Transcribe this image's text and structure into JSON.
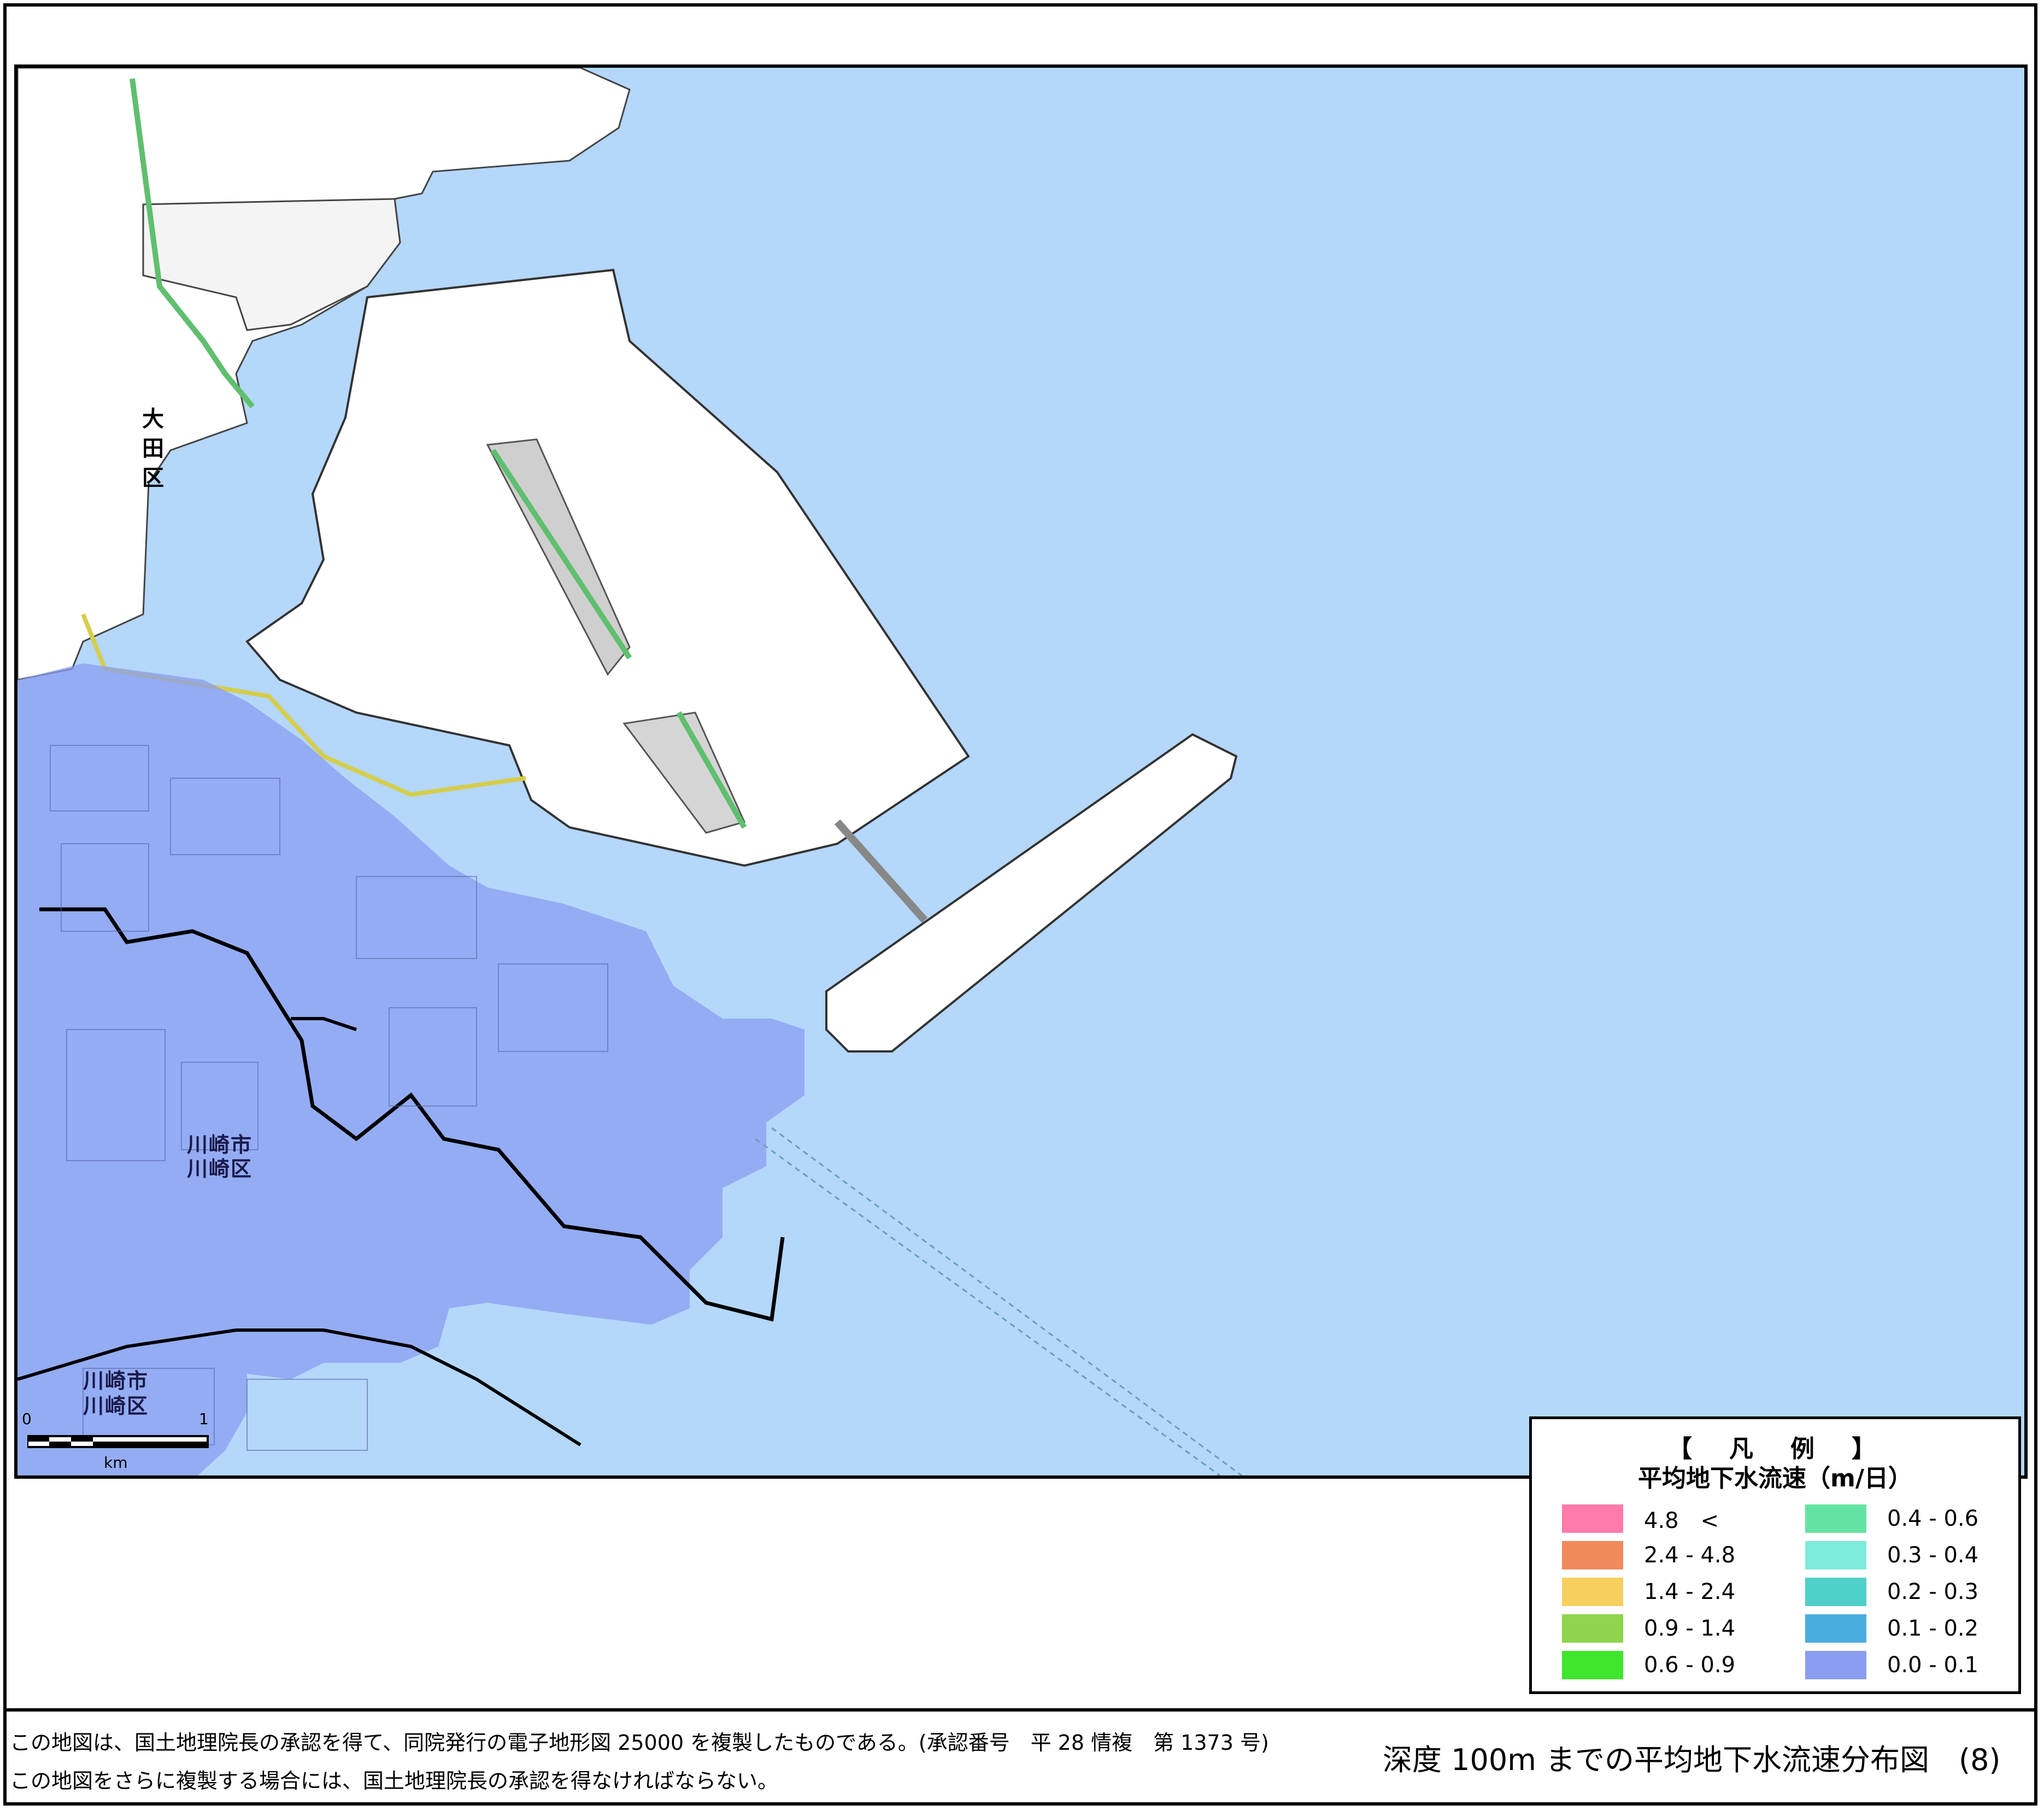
{
  "map": {
    "title": "深度 100m までの平均地下水流速分布図　(8)",
    "place_labels": {
      "ota": "大田区",
      "kawasaki_city_1": "川崎市",
      "kawasaki_ward_1": "川崎区",
      "kawasaki_city_2": "川崎市",
      "kawasaki_ward_2": "川崎区"
    },
    "scale_bar": {
      "start": "0",
      "end": "1",
      "unit": "km"
    }
  },
  "legend": {
    "title": "【　凡　例　】",
    "subtitle": "平均地下水流速（m/日）",
    "items": [
      {
        "label": "4.8　<",
        "color": "#ff7bab"
      },
      {
        "label": "2.4 - 4.8",
        "color": "#f08a5d"
      },
      {
        "label": "1.4 - 2.4",
        "color": "#f7cf5e"
      },
      {
        "label": "0.9 - 1.4",
        "color": "#8fd44a"
      },
      {
        "label": "0.6 - 0.9",
        "color": "#3ee62d"
      },
      {
        "label": "0.4 - 0.6",
        "color": "#63e3a3"
      },
      {
        "label": "0.3 - 0.4",
        "color": "#7deadb"
      },
      {
        "label": "0.2 - 0.3",
        "color": "#4fd0c8"
      },
      {
        "label": "0.1 - 0.2",
        "color": "#4aaddf"
      },
      {
        "label": "0.0 - 0.1",
        "color": "#8a9df0"
      }
    ]
  },
  "notes": {
    "line1": "この地図は、国土地理院長の承認を得て、同院発行の電子地形図 25000 を複製したものである。(承認番号　平 28 情複　第 1373 号)",
    "line2": "この地図をさらに複製する場合には、国土地理院長の承認を得なければならない。"
  },
  "colors": {
    "sea": "#b4d7fa",
    "land": "#ffffff",
    "flow_zone": "#8a9df0"
  }
}
